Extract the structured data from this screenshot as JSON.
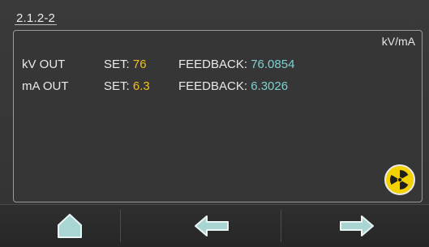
{
  "screen": {
    "title": "2.1.2-2"
  },
  "panel": {
    "units": "kV/mA",
    "rows": [
      {
        "label": "kV OUT",
        "set_label": "SET:",
        "set_value": "76",
        "feedback_label": "FEEDBACK:",
        "feedback_value": "76.0854"
      },
      {
        "label": "mA OUT",
        "set_label": "SET:",
        "set_value": "6.3",
        "feedback_label": "FEEDBACK:",
        "feedback_value": "6.3026"
      }
    ],
    "radiation_icon": "radiation-icon"
  },
  "navbar": {
    "home_icon": "home-icon",
    "back_icon": "arrow-left-icon",
    "next_icon": "arrow-right-icon"
  },
  "colors": {
    "set_value": "#f0c020",
    "feedback_value": "#7fd0d0",
    "radiation_bg": "#f4d100",
    "nav_icon_fill": "#a9d6d2"
  }
}
